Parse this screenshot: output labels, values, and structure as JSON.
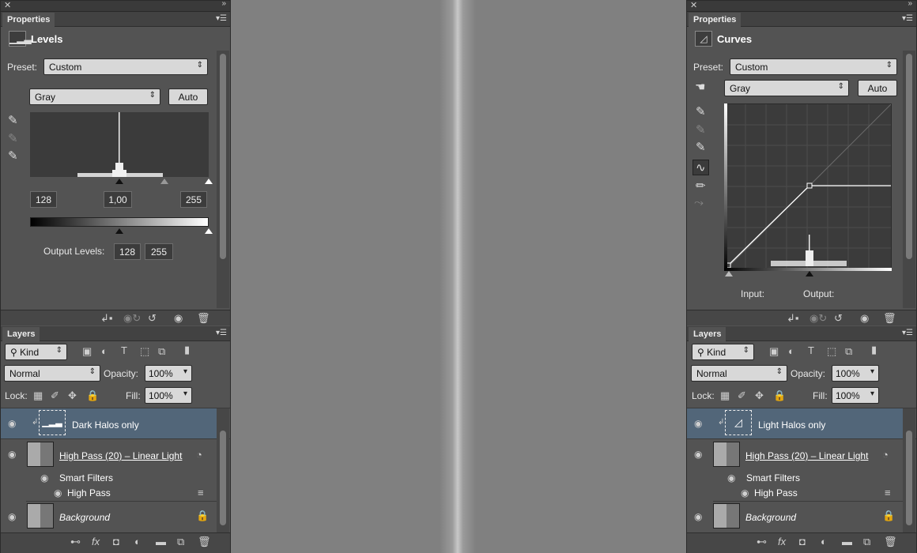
{
  "left": {
    "properties_tab": "Properties",
    "title": "Levels",
    "preset_label": "Preset:",
    "preset_value": "Custom",
    "channel_value": "Gray",
    "auto_label": "Auto",
    "input_black": "128",
    "input_gamma": "1,00",
    "input_white": "255",
    "output_label": "Output Levels:",
    "output_black": "128",
    "output_white": "255"
  },
  "right": {
    "properties_tab": "Properties",
    "title": "Curves",
    "preset_label": "Preset:",
    "preset_value": "Custom",
    "channel_value": "Gray",
    "auto_label": "Auto",
    "input_label": "Input:",
    "output_label": "Output:"
  },
  "layers_common": {
    "tab": "Layers",
    "filter_value": "Kind",
    "blend_mode": "Normal",
    "opacity_label": "Opacity:",
    "opacity_value": "100%",
    "lock_label": "Lock:",
    "fill_label": "Fill:",
    "fill_value": "100%",
    "highpass_layer": "High Pass (20) – Linear Light",
    "smart_filters": "Smart Filters",
    "high_pass": "High Pass",
    "background": "Background"
  },
  "layers_left": {
    "adjustment_layer": "Dark Halos only"
  },
  "layers_right": {
    "adjustment_layer": "Light Halos only"
  },
  "icons": [
    "close-icon",
    "collapse-icon",
    "panel-menu-icon",
    "levels-icon",
    "curves-icon",
    "eyedropper-black-icon",
    "eyedropper-gray-icon",
    "eyedropper-white-icon",
    "hand-target-icon",
    "curve-tool-icon",
    "pencil-icon",
    "smooth-icon",
    "clip-icon",
    "view-previous-icon",
    "reset-icon",
    "visibility-icon",
    "trash-icon",
    "eye-icon",
    "lock-icon",
    "link-icon",
    "fx-icon",
    "mask-icon",
    "adjustment-icon",
    "folder-icon",
    "new-layer-icon"
  ],
  "colors": {
    "panel": "#535353",
    "selected_layer": "#526679",
    "canvas": "#808080"
  }
}
